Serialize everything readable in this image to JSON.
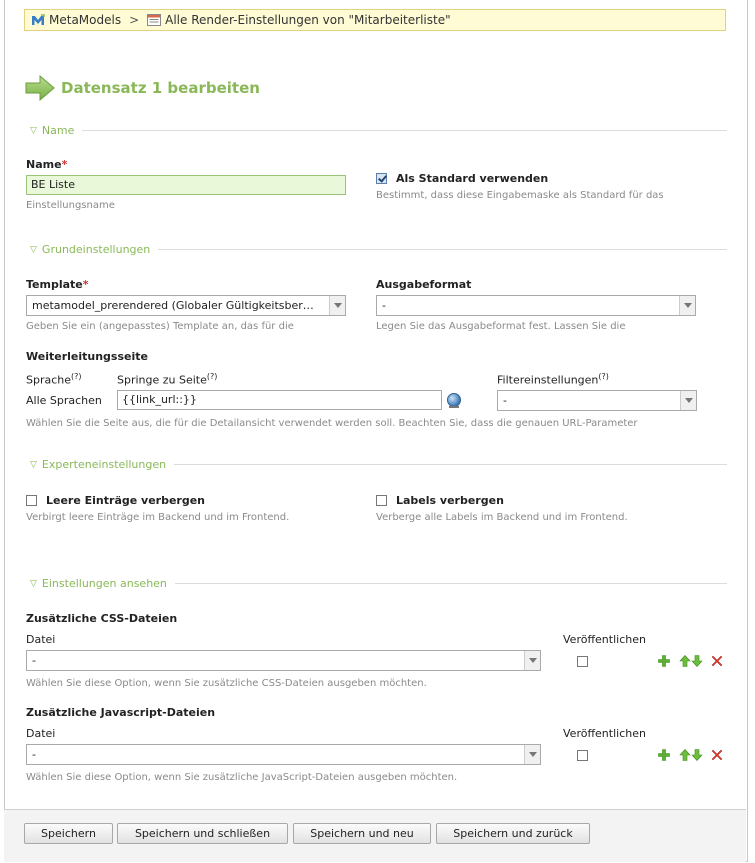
{
  "breadcrumb": {
    "root": "MetaModels",
    "separator": ">",
    "current": "Alle Render-Einstellungen von \"Mitarbeiterliste\""
  },
  "page_title": "Datensatz 1 bearbeiten",
  "sections": {
    "name": "Name",
    "grund": "Grundeinstellungen",
    "experten": "Experteneinstellungen",
    "ansehen": "Einstellungen ansehen"
  },
  "fields": {
    "name": {
      "label": "Name",
      "required": "*",
      "value": "BE Liste",
      "help": "Einstellungsname"
    },
    "default": {
      "label": "Als Standard verwenden",
      "checked": true,
      "help": "Bestimmt, dass diese Eingabemaske als Standard für das"
    },
    "template": {
      "label": "Template",
      "required": "*",
      "value": "metamodel_prerendered (Globaler Gültigkeitsber…",
      "help": "Geben Sie ein (angepasstes) Template an, das für die"
    },
    "ausgabeformat": {
      "label": "Ausgabeformat",
      "value": "-",
      "help": "Legen Sie das Ausgabeformat fest. Lassen Sie die"
    },
    "weiterleitung": {
      "label": "Weiterleitungsseite",
      "col_sprache": "Sprache",
      "col_springe": "Springe zu Seite",
      "col_filter": "Filtereinstellungen",
      "help_mark": "(?)",
      "row_sprache": "Alle Sprachen",
      "row_url": "{{link_url::}}",
      "row_filter": "-",
      "help": "Wählen Sie die Seite aus, die für die Detailansicht verwendet werden soll. Beachten Sie, dass die genauen URL-Parameter"
    },
    "leere": {
      "label": "Leere Einträge verbergen",
      "checked": false,
      "help": "Verbirgt leere Einträge im Backend und im Frontend."
    },
    "labels": {
      "label": "Labels verbergen",
      "checked": false,
      "help": "Verberge alle Labels im Backend und im Frontend."
    },
    "css": {
      "label": "Zusätzliche CSS-Dateien",
      "col_datei": "Datei",
      "col_pub": "Veröffentlichen",
      "value": "-",
      "help": "Wählen Sie diese Option, wenn Sie zusätzliche CSS-Dateien ausgeben möchten."
    },
    "js": {
      "label": "Zusätzliche Javascript-Dateien",
      "col_datei": "Datei",
      "col_pub": "Veröffentlichen",
      "value": "-",
      "help": "Wählen Sie diese Option, wenn Sie zusätzliche JavaScript-Dateien ausgeben möchten."
    }
  },
  "buttons": {
    "save": "Speichern",
    "save_close": "Speichern und schließen",
    "save_new": "Speichern und neu",
    "save_back": "Speichern und zurück"
  },
  "colors": {
    "accent_green": "#8ab858",
    "breadcrumb_bg": "#fffbd4"
  }
}
